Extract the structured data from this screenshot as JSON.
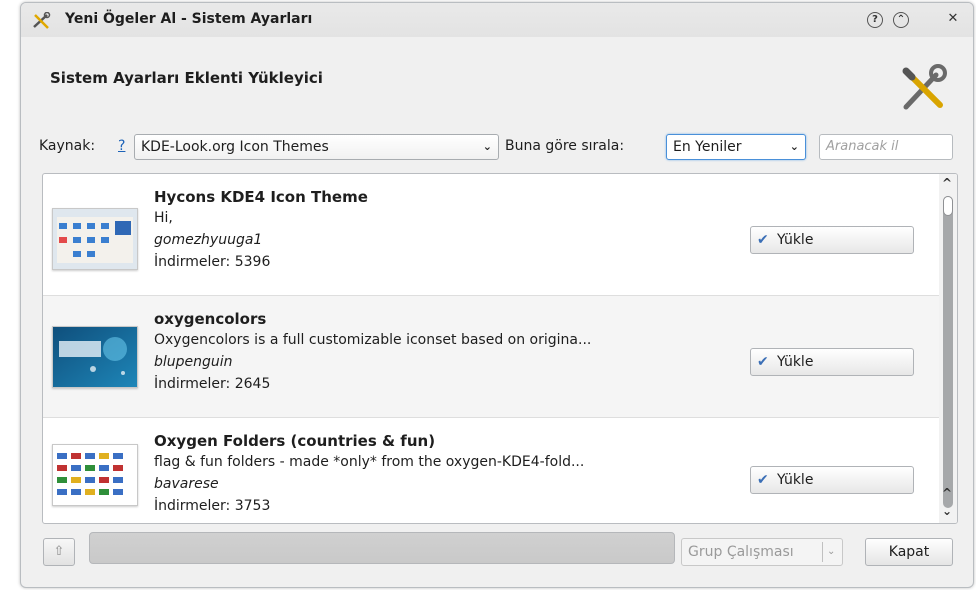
{
  "window": {
    "title": "Yeni Ögeler Al - Sistem Ayarları",
    "title_buttons": {
      "help": "?",
      "minimize": "⌃",
      "close": "✕"
    }
  },
  "header": {
    "heading": "Sistem Ayarları Eklenti Yükleyici",
    "icon": "tools-icon"
  },
  "toolbar": {
    "source_label": "Kaynak:",
    "source_help": "?",
    "source_value": "KDE-Look.org Icon Themes",
    "sort_label": "Buna göre sırala:",
    "sort_value": "En Yeniler",
    "search_placeholder": "Aranacak il"
  },
  "items": [
    {
      "name": "Hycons KDE4 Icon Theme",
      "description": "Hi,",
      "author": "gomezhyuuga1",
      "downloads": "İndirmeler: 5396",
      "install_label": "Yükle"
    },
    {
      "name": "oxygencolors",
      "description": "Oxygencolors is a full customizable iconset based on origina...",
      "author": "blupenguin",
      "downloads": "İndirmeler: 2645",
      "install_label": "Yükle"
    },
    {
      "name": "Oxygen Folders (countries & fun)",
      "description": "flag & fun folders - made *only* from the oxygen-KDE4-fold...",
      "author": "bavarese",
      "downloads": "İndirmeler: 3753",
      "install_label": "Yükle"
    }
  ],
  "footer": {
    "group_label": "Grup Çalışması",
    "close_label": "Kapat"
  },
  "colors": {
    "link": "#1d63b8",
    "check": "#3b6fb6",
    "focus": "#4a90d9"
  }
}
